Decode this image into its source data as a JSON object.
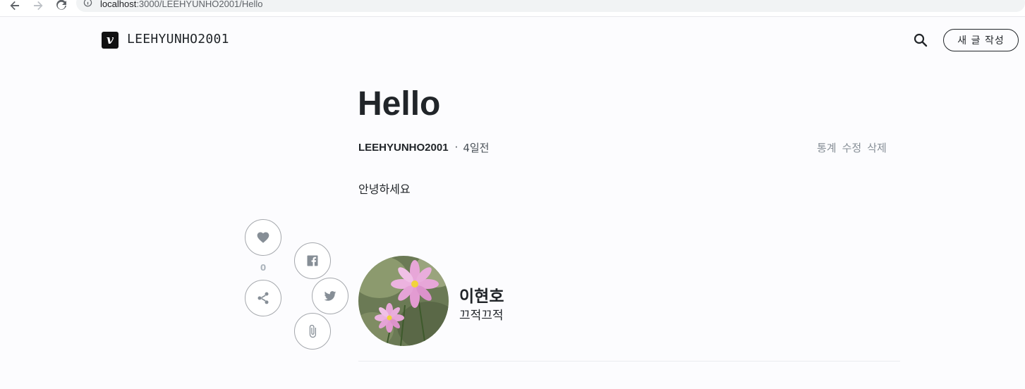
{
  "browser": {
    "url_host": "localhost",
    "url_path": ":3000/LEEHYUNHO2001/Hello"
  },
  "header": {
    "logo_letter": "v",
    "blog_name": "LEEHYUNHO2001",
    "write_button": "새 글 작성"
  },
  "post": {
    "title": "Hello",
    "author": "LEEHYUNHO2001",
    "separator": "·",
    "date": "4일전",
    "actions": [
      "통계",
      "수정",
      "삭제"
    ],
    "body": "안녕하세요"
  },
  "share": {
    "like_count": "0"
  },
  "profile": {
    "name": "이현호",
    "description": "끄적끄적"
  },
  "colors": {
    "background": "#fcfcfe",
    "text": "#212529",
    "muted": "#868e96"
  }
}
